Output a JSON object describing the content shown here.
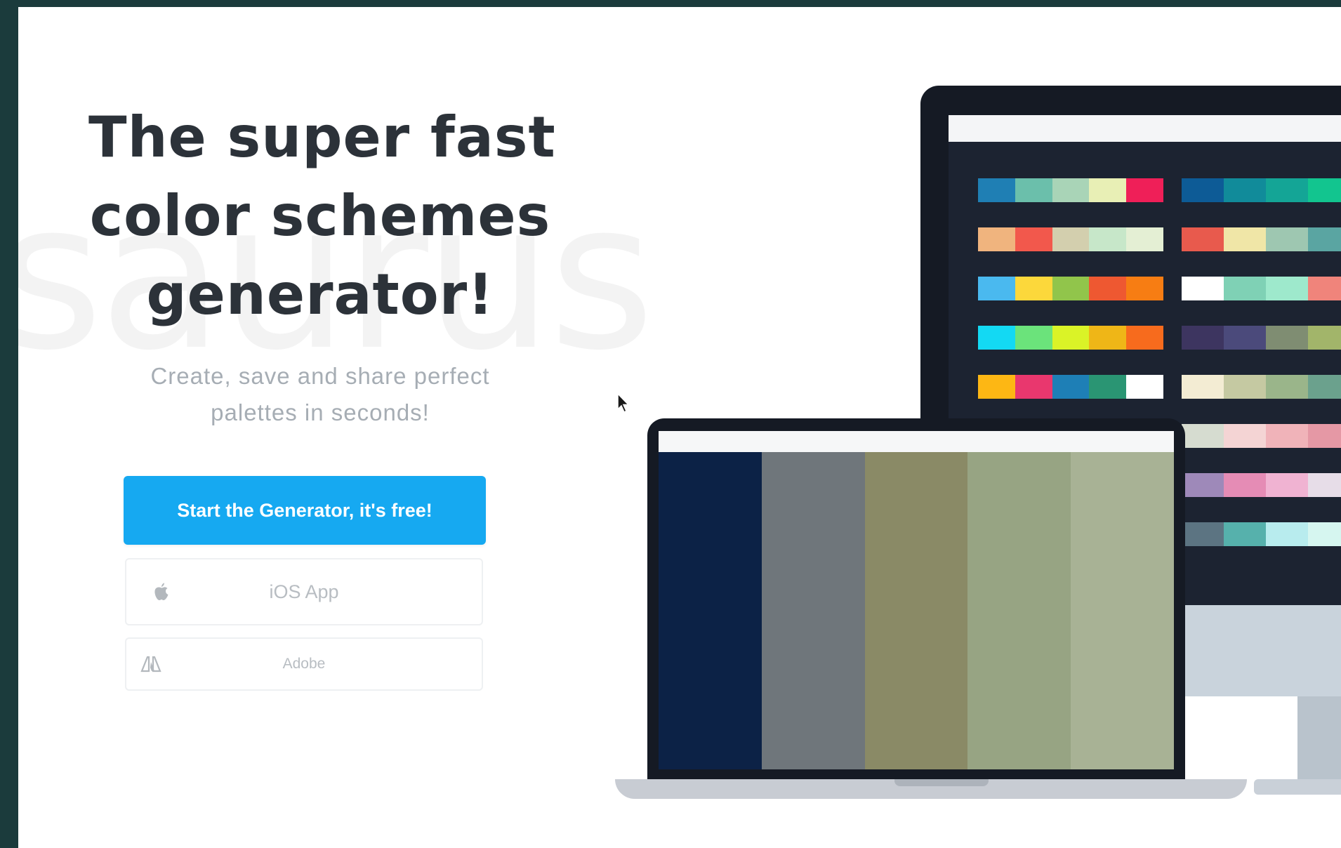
{
  "watermark": "saurus",
  "hero": {
    "title_lines": [
      "The super fast",
      "color schemes",
      "generator!"
    ],
    "subtitle_lines": [
      "Create, save and share perfect",
      "palettes in seconds!"
    ]
  },
  "buttons": {
    "primary": "Start the Generator, it's free!",
    "ios": "iOS App",
    "adobe": "Adobe"
  },
  "icons": {
    "ios": "apple-icon",
    "adobe": "adobe-icon",
    "cursor": "mouse-cursor-icon"
  },
  "colors": {
    "accent": "#16a9f1",
    "title": "#2c3239",
    "subtitle": "#a6adb4",
    "device_dark": "#151a24",
    "background": "#1b3b3c"
  },
  "laptop_palette": [
    "#0c2246",
    "#6f767b",
    "#8a8a66",
    "#97a483",
    "#a8b295"
  ],
  "monitor_palettes": {
    "left": [
      [
        "#1f7fb4",
        "#6bbfab",
        "#a9d4b7",
        "#e8efb5",
        "#ef1f58"
      ],
      [
        "#f0b47e",
        "#f2584c",
        "#d3cfae",
        "#c7e7c9",
        "#e4efd4"
      ],
      [
        "#4ab9ef",
        "#fcd83b",
        "#91c54b",
        "#ee5831",
        "#f77d13"
      ],
      [
        "#13d9f3",
        "#6be37b",
        "#daf327",
        "#efb617",
        "#f76b1d"
      ],
      [
        "#fdb714",
        "#e9376e",
        "#1e7fb6",
        "#2a9573",
        "#ffffff"
      ]
    ],
    "right": [
      [
        "#0d5b96",
        "#118b9a",
        "#14a596",
        "#12c58f",
        "#e8e25a"
      ],
      [
        "#e85a4d",
        "#f0e6a7",
        "#9ec7b1",
        "#5aa5a2",
        "#e9ecec"
      ],
      [
        "#ffffff",
        "#7fd1b5",
        "#9ee9cc",
        "#f0847b",
        "#f39c95"
      ],
      [
        "#3d3560",
        "#4b4a7b",
        "#7f8d72",
        "#a2b56a",
        "#e8e25c"
      ],
      [
        "#f3ecd3",
        "#c5c9a2",
        "#9ab58a",
        "#6ba18d",
        "#7fb19b"
      ],
      [
        "#d6dcd0",
        "#f4d4d4",
        "#f0b3b9",
        "#e598a5",
        "#ececec"
      ],
      [
        "#9e89b9",
        "#e58cb5",
        "#f0b3d2",
        "#e7dde8",
        "#ffffff"
      ],
      [
        "#5c7482",
        "#56b1ac",
        "#b8ecee",
        "#d6f6f0",
        "#ffffff"
      ]
    ]
  }
}
